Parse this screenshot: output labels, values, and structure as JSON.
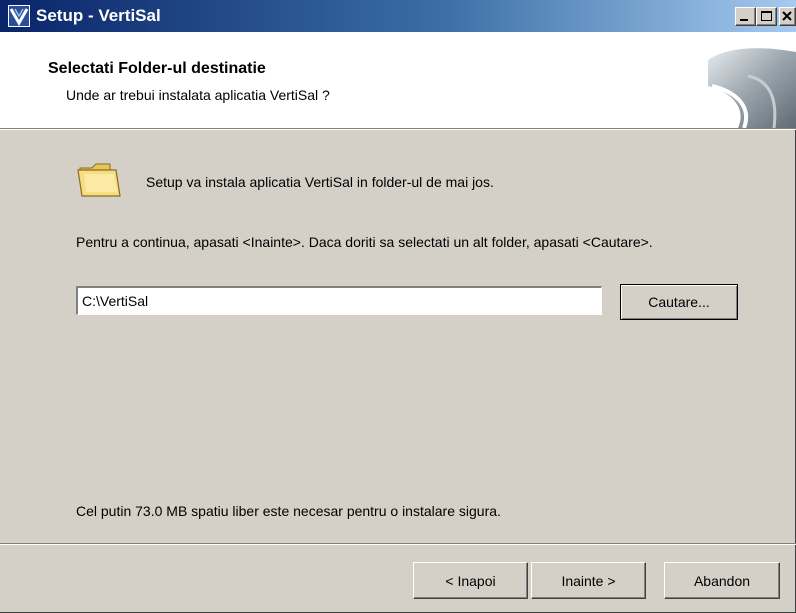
{
  "window": {
    "title": "Setup - VertiSal",
    "controls": [
      "minimize",
      "maximize",
      "close"
    ]
  },
  "header": {
    "title": "Selectati Folder-ul destinatie",
    "subtitle": "Unde ar trebui instalata aplicatia VertiSal ?"
  },
  "body": {
    "intro": "Setup va instala aplicatia VertiSal in folder-ul de mai jos.",
    "instruction": "Pentru a continua, apasati <Inainte>. Daca doriti sa selectati un alt folder, apasati <Cautare>.",
    "path_value": "C:\\VertiSal",
    "browse_label": "Cautare...",
    "space_note": "Cel putin 73.0 MB spatiu liber este necesar pentru o instalare sigura."
  },
  "footer": {
    "back_label": "< Inapoi",
    "next_label": "Inainte >",
    "cancel_label": "Abandon"
  },
  "colors": {
    "titlebar_start": "#0a246a",
    "titlebar_end": "#a6caf0",
    "dialog_bg": "#d4d0c8",
    "header_bg": "#ffffff"
  },
  "icons": [
    "setup-app-icon",
    "minimize-icon",
    "maximize-icon",
    "close-icon",
    "wizard-image-icon",
    "folder-icon"
  ]
}
